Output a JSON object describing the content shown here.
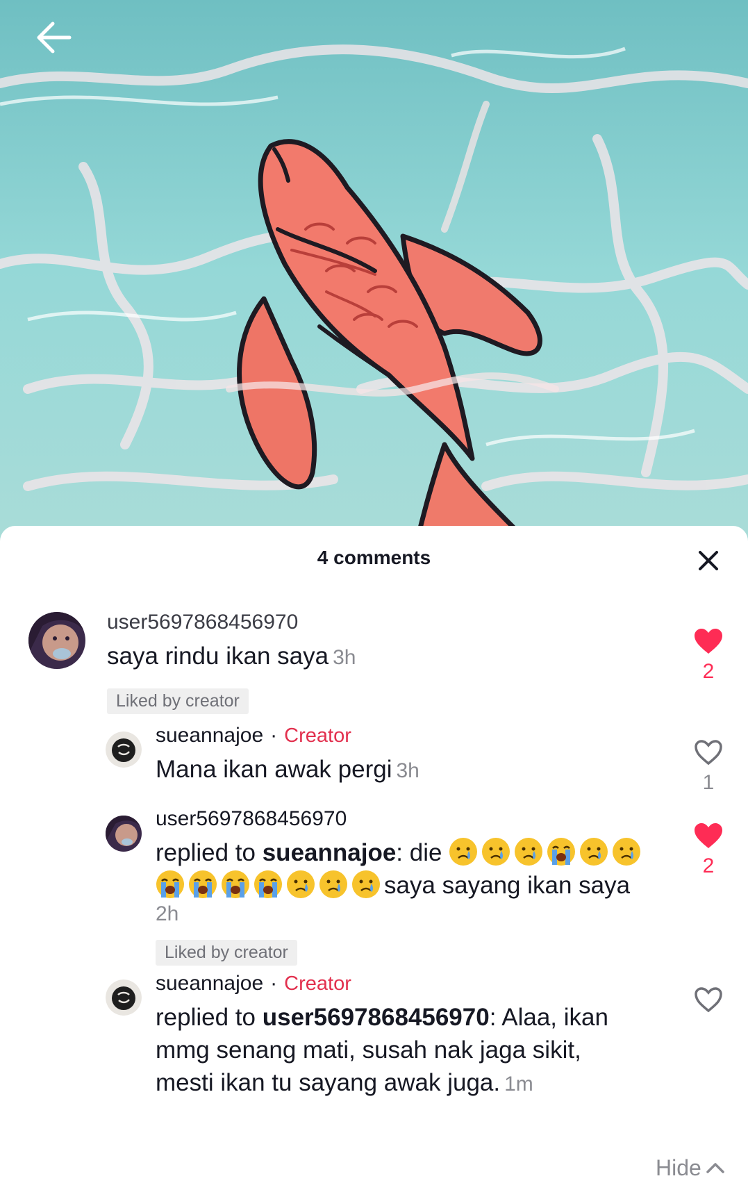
{
  "header": {
    "back_icon": "arrow-left-icon"
  },
  "sheet": {
    "title": "4 comments",
    "close_icon": "close-icon",
    "hide_label": "Hide",
    "hide_icon": "chevron-up-icon"
  },
  "colors": {
    "accent": "#fe2c55",
    "creator": "#e2304e",
    "muted": "#8a8b91",
    "water": "#8fd3d4",
    "fish": "#f27a6c"
  },
  "comments": [
    {
      "username": "user5697868456970",
      "text": "saya rindu ikan saya",
      "time": "3h",
      "liked_by_creator": "Liked by creator",
      "likes": "2",
      "liked": true
    },
    {
      "username": "sueannajoe",
      "separator": "·",
      "creator_tag": "Creator",
      "text": "Mana ikan awak pergi",
      "time": "3h",
      "likes": "1",
      "liked": false
    },
    {
      "username": "user5697868456970",
      "reply_prefix": "replied to ",
      "reply_to": "sueannajoe",
      "reply_sep": ": ",
      "text_a": "die",
      "text_b": "saya sayang ikan saya",
      "emoji_sequence": [
        "cry",
        "cry",
        "cry",
        "sob",
        "cry",
        "cry",
        "sob",
        "sob",
        "sob",
        "sob",
        "cry",
        "cry",
        "cry"
      ],
      "time": "2h",
      "liked_by_creator": "Liked by creator",
      "likes": "2",
      "liked": true
    },
    {
      "username": "sueannajoe",
      "separator": "·",
      "creator_tag": "Creator",
      "reply_prefix": "replied to ",
      "reply_to": "user5697868456970",
      "reply_sep": ": ",
      "text_line1": "Alaa, ikan",
      "text_line2": "mmg senang mati, susah nak jaga sikit,",
      "text_line3": "mesti ikan tu sayang awak juga.",
      "time": "1m",
      "liked": false
    }
  ]
}
